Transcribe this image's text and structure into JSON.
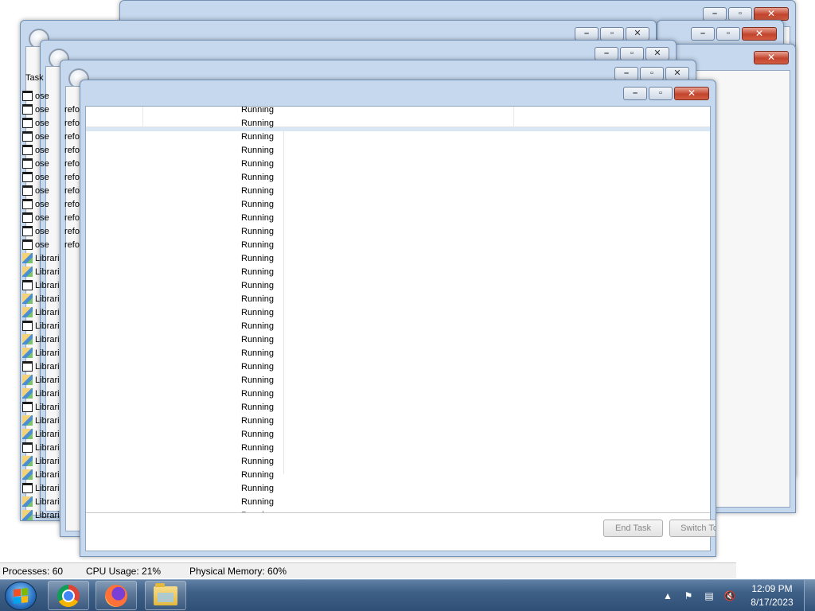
{
  "back_windows": {
    "tasks_label": "Task",
    "left_rows_close": [
      "ose",
      "ose",
      "ose",
      "ose",
      "ose",
      "ose",
      "ose",
      "ose",
      "ose",
      "ose",
      "ose",
      "ose"
    ],
    "left_rows_refresh": [
      "refo",
      "refo",
      "refo",
      "refo",
      "refo",
      "refo",
      "refo",
      "refo",
      "refo",
      "refo",
      "refo"
    ],
    "left_rows_lib": [
      "Librari",
      "Librari",
      "Librari",
      "Librari",
      "Librari",
      "Librari",
      "Librari",
      "Librari",
      "Librari",
      "Librari",
      "Librari",
      "Librari",
      "Librari",
      "Librari",
      "Librari",
      "Librari",
      "Librari",
      "Librari",
      "Librari",
      "Librari"
    ]
  },
  "task_manager": {
    "status_value": "Running",
    "row_count": 31,
    "buttons": {
      "end_task": "End Task",
      "switch_to": "Switch To"
    }
  },
  "statusbar": {
    "processes": "Processes: 60",
    "cpu": "CPU Usage: 21%",
    "memory": "Physical Memory: 60%"
  },
  "taskbar": {
    "time": "12:09 PM",
    "date": "8/17/2023"
  }
}
